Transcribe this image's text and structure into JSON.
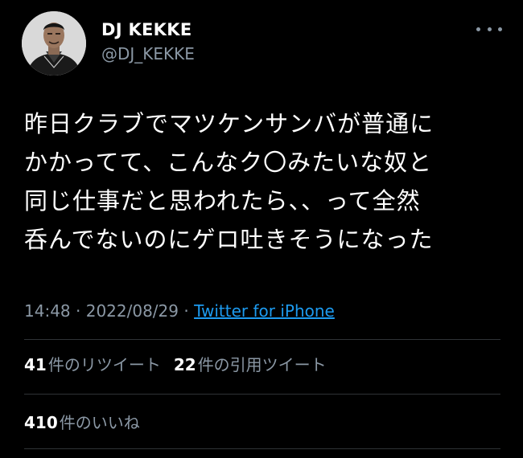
{
  "author": {
    "display_name": "DJ KEKKE",
    "handle": "@DJ_KEKKE",
    "avatar_icon": "user-avatar-photo"
  },
  "tweet": {
    "lines": [
      "昨日クラブでマツケンサンバが普通に",
      "かかってて、こんなク〇みたいな奴と",
      "同じ仕事だと思われたら、、って全然",
      "呑んでないのにゲロ吐きそうになった"
    ],
    "time": "14:48",
    "separator1": "·",
    "date": "2022/08/29",
    "separator2": "·",
    "source": "Twitter for iPhone"
  },
  "stats": {
    "retweets": {
      "count": "41",
      "label": "件のリツイート"
    },
    "quotes": {
      "count": "22",
      "label": "件の引用ツイート"
    },
    "likes": {
      "count": "410",
      "label": "件のいいね"
    }
  },
  "colors": {
    "background": "#000000",
    "primary_text": "#ffffff",
    "secondary_text": "#8b98a5",
    "link": "#1d9bf0",
    "divider": "#2f3336"
  }
}
